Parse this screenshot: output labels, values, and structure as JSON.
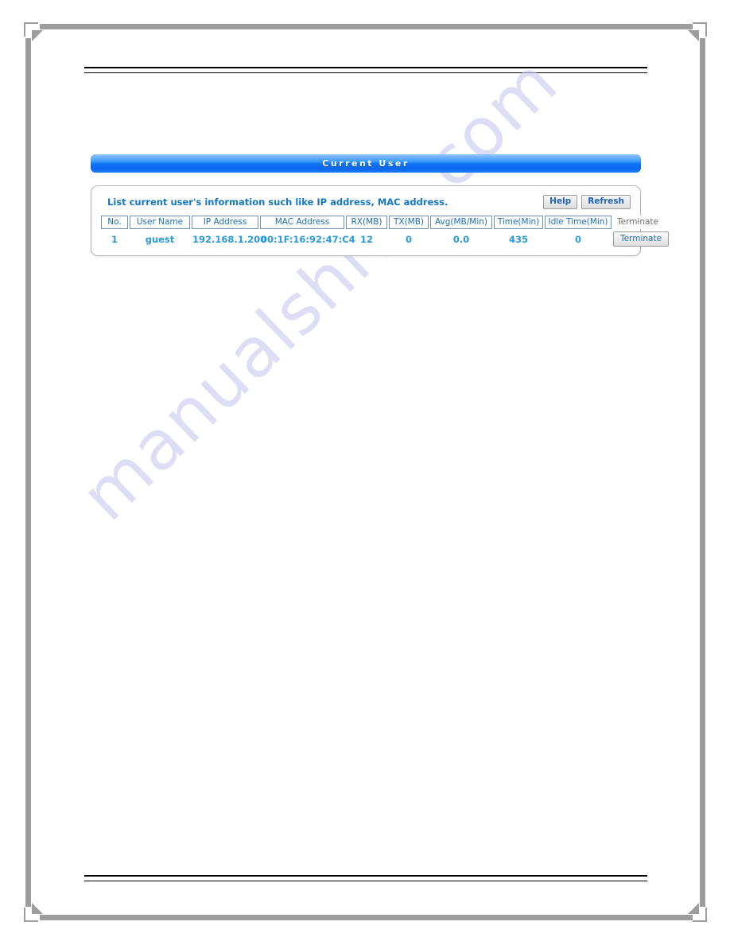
{
  "page": {
    "watermark": "manualshive.com"
  },
  "panel": {
    "title": "Current User",
    "description": "List current user's information such like IP address, MAC address.",
    "help_label": "Help",
    "refresh_label": "Refresh",
    "accent_color": "#0e74f4",
    "link_color": "#1577c4",
    "value_color": "#2a9ae0"
  },
  "table": {
    "columns": [
      "No.",
      "User Name",
      "IP Address",
      "MAC Address",
      "RX(MB)",
      "TX(MB)",
      "Avg(MB/Min)",
      "Time(Min)",
      "Idle Time(Min)",
      "Terminate"
    ],
    "rows": [
      {
        "no": "1",
        "user_name": "guest",
        "ip_address": "192.168.1.200",
        "mac_address": "00:1F:16:92:47:C4",
        "rx_mb": "12",
        "tx_mb": "0",
        "avg_mb_min": "0.0",
        "time_min": "435",
        "idle_time_min": "0",
        "terminate_label": "Terminate"
      }
    ]
  }
}
